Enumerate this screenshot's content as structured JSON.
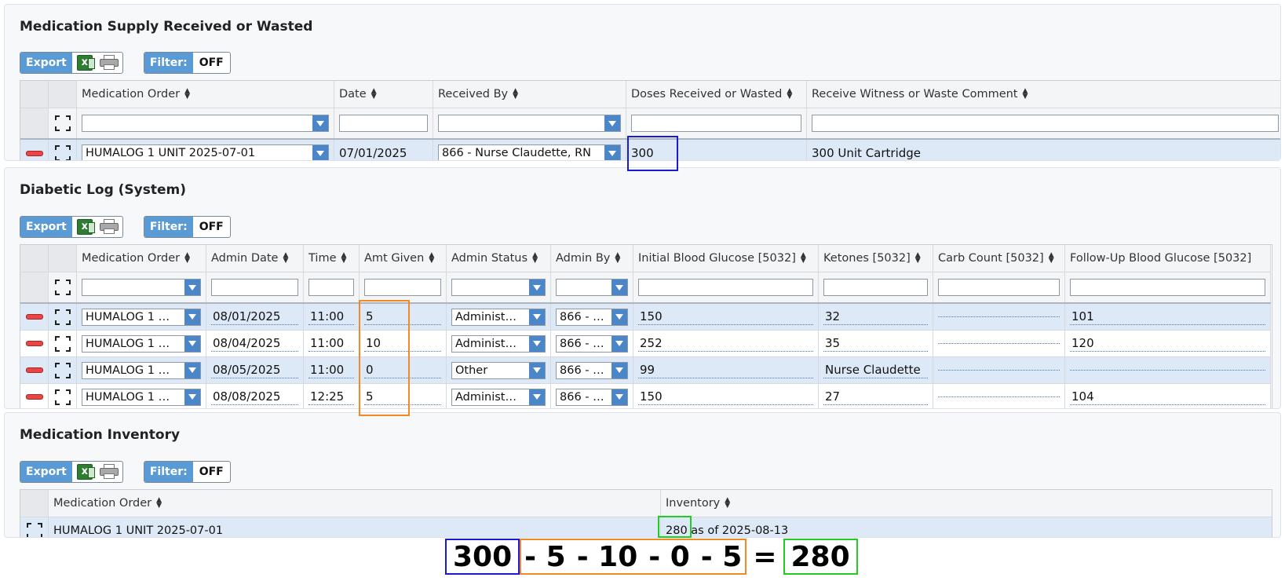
{
  "supply": {
    "title": "Medication Supply Received or Wasted",
    "export_label": "Export",
    "filter_label": "Filter:",
    "filter_state": "OFF",
    "columns": [
      "Medication Order",
      "Date",
      "Received By",
      "Doses Received or Wasted",
      "Receive Witness or Waste Comment"
    ],
    "row": {
      "medication_order": "HUMALOG 1 UNIT 2025-07-01",
      "date": "07/01/2025",
      "received_by": "866 - Nurse Claudette, RN",
      "doses": "300",
      "comment": "300 Unit Cartridge"
    }
  },
  "diabetic": {
    "title": "Diabetic Log (System)",
    "export_label": "Export",
    "filter_label": "Filter:",
    "filter_state": "OFF",
    "columns": [
      "Medication Order",
      "Admin Date",
      "Time",
      "Amt Given",
      "Admin Status",
      "Admin By",
      "Initial Blood Glucose [5032]",
      "Ketones [5032]",
      "Carb Count [5032]",
      "Follow-Up Blood Glucose [5032]"
    ],
    "rows": [
      {
        "order": "HUMALOG 1 …",
        "date": "08/01/2025",
        "time": "11:00",
        "amt": "5",
        "status": "Administ…",
        "by": "866 - …",
        "ibg": "150",
        "ketones": "32",
        "carb": "",
        "fbg": "101"
      },
      {
        "order": "HUMALOG 1 …",
        "date": "08/04/2025",
        "time": "11:00",
        "amt": "10",
        "status": "Administ…",
        "by": "866 - …",
        "ibg": "252",
        "ketones": "35",
        "carb": "",
        "fbg": "120"
      },
      {
        "order": "HUMALOG 1 …",
        "date": "08/05/2025",
        "time": "11:00",
        "amt": "0",
        "status": "Other",
        "by": "866 - …",
        "ibg": "99",
        "ketones": "Nurse Claudette",
        "carb": "",
        "fbg": ""
      },
      {
        "order": "HUMALOG 1 …",
        "date": "08/08/2025",
        "time": "12:25",
        "amt": "5",
        "status": "Administ…",
        "by": "866 - …",
        "ibg": "150",
        "ketones": "27",
        "carb": "",
        "fbg": "104"
      }
    ]
  },
  "inventory": {
    "title": "Medication Inventory",
    "export_label": "Export",
    "filter_label": "Filter:",
    "filter_state": "OFF",
    "columns": [
      "Medication Order",
      "Inventory"
    ],
    "row": {
      "medication_order": "HUMALOG 1 UNIT 2025-07-01",
      "inventory_value": "280",
      "inventory_suffix": " as of 2025-08-13"
    }
  },
  "equation": {
    "received": "300",
    "subtractions": [
      "- 5",
      "- 10",
      "- 0",
      "- 5"
    ],
    "equals": "=",
    "result": "280"
  },
  "colors": {
    "highlight_received": "#1a1ad6",
    "highlight_given": "#f08a24",
    "highlight_result": "#22cc22"
  }
}
